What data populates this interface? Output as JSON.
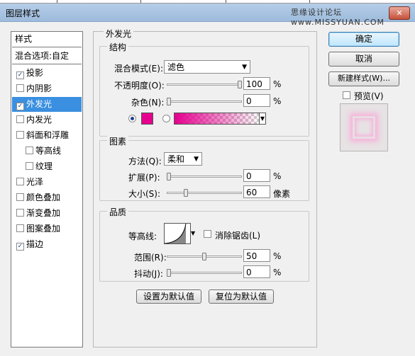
{
  "window": {
    "title": "图层样式",
    "watermark": "思缘设计论坛 www.MISSYUAN.COM",
    "close_glyph": "✕"
  },
  "left_panel": {
    "header": "样式",
    "blend_options": "混合选项:自定",
    "items": [
      {
        "label": "投影",
        "checked": true,
        "indent": false,
        "selected": false
      },
      {
        "label": "内阴影",
        "checked": false,
        "indent": false,
        "selected": false
      },
      {
        "label": "外发光",
        "checked": true,
        "indent": false,
        "selected": true
      },
      {
        "label": "内发光",
        "checked": false,
        "indent": false,
        "selected": false
      },
      {
        "label": "斜面和浮雕",
        "checked": false,
        "indent": false,
        "selected": false
      },
      {
        "label": "等高线",
        "checked": false,
        "indent": true,
        "selected": false
      },
      {
        "label": "纹理",
        "checked": false,
        "indent": true,
        "selected": false
      },
      {
        "label": "光泽",
        "checked": false,
        "indent": false,
        "selected": false
      },
      {
        "label": "颜色叠加",
        "checked": false,
        "indent": false,
        "selected": false
      },
      {
        "label": "渐变叠加",
        "checked": false,
        "indent": false,
        "selected": false
      },
      {
        "label": "图案叠加",
        "checked": false,
        "indent": false,
        "selected": false
      },
      {
        "label": "描边",
        "checked": true,
        "indent": false,
        "selected": false
      }
    ]
  },
  "main": {
    "section_title": "外发光",
    "structure": {
      "title": "结构",
      "blend_mode_label": "混合模式(E):",
      "blend_mode_value": "滤色",
      "opacity_label": "不透明度(O):",
      "opacity_value": "100",
      "opacity_unit": "%",
      "opacity_fraction": 1.0,
      "noise_label": "杂色(N):",
      "noise_value": "0",
      "noise_unit": "%",
      "noise_fraction": 0.0,
      "glow_color": "#e5008e"
    },
    "elements": {
      "title": "图素",
      "technique_label": "方法(Q):",
      "technique_value": "柔和",
      "spread_label": "扩展(P):",
      "spread_value": "0",
      "spread_unit": "%",
      "spread_fraction": 0.0,
      "size_label": "大小(S):",
      "size_value": "60",
      "size_unit": "像素",
      "size_fraction": 0.24
    },
    "quality": {
      "title": "品质",
      "contour_label": "等高线:",
      "antialias_label": "消除锯齿(L)",
      "range_label": "范围(R):",
      "range_value": "50",
      "range_unit": "%",
      "range_fraction": 0.5,
      "jitter_label": "抖动(J):",
      "jitter_value": "0",
      "jitter_unit": "%",
      "jitter_fraction": 0.0
    },
    "make_default": "设置为默认值",
    "reset_default": "复位为默认值"
  },
  "right": {
    "ok": "确定",
    "cancel": "取消",
    "new_style": "新建样式(W)...",
    "preview_label": "预览(V)"
  }
}
